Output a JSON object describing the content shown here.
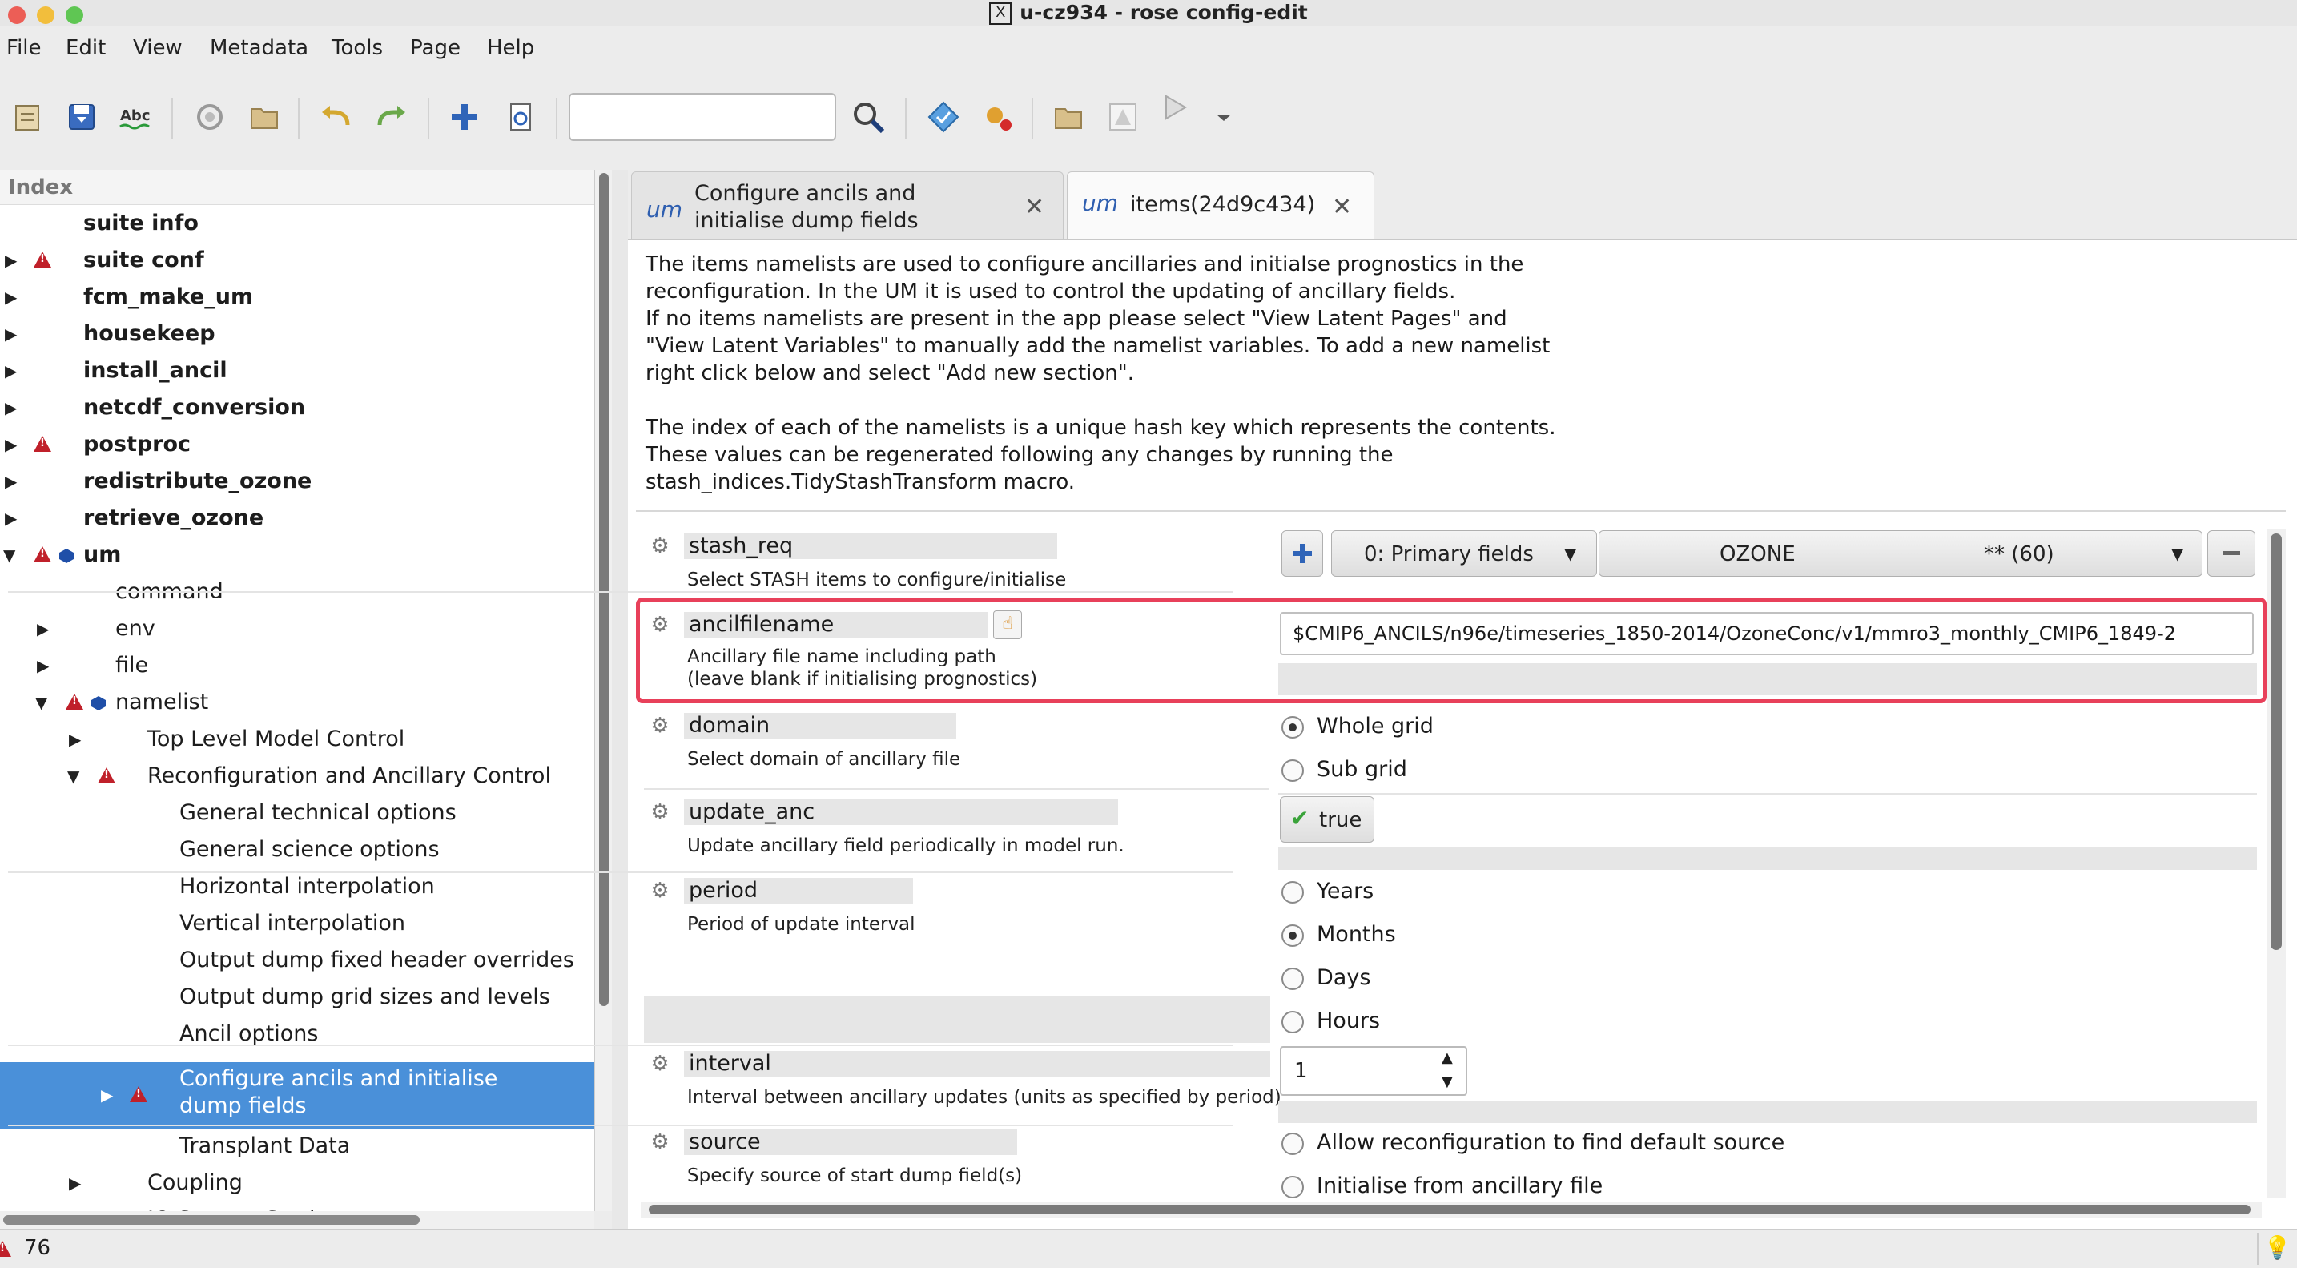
{
  "window": {
    "title": "u-cz934 - rose config-edit"
  },
  "menu": [
    "File",
    "Edit",
    "View",
    "Metadata",
    "Tools",
    "Page",
    "Help"
  ],
  "toolbar": {
    "search_value": "",
    "icons": [
      "open-icon",
      "save-icon",
      "spell-check-icon",
      "reload-icon",
      "folder-icon",
      "undo-icon",
      "redo-icon",
      "add-icon",
      "refresh-page-icon",
      "search-icon",
      "validate-icon",
      "macro-icon",
      "folder-open-icon",
      "warning-icon",
      "run-icon",
      "dropdown-icon"
    ]
  },
  "index": {
    "header": "Index",
    "items": [
      {
        "label": "suite info"
      },
      {
        "label": "suite conf"
      },
      {
        "label": "fcm_make_um"
      },
      {
        "label": "housekeep"
      },
      {
        "label": "install_ancil"
      },
      {
        "label": "netcdf_conversion"
      },
      {
        "label": "postproc"
      },
      {
        "label": "redistribute_ozone"
      },
      {
        "label": "retrieve_ozone"
      },
      {
        "label": "um"
      },
      {
        "label": "command"
      },
      {
        "label": "env"
      },
      {
        "label": "file"
      },
      {
        "label": "namelist"
      },
      {
        "label": "Top Level Model Control"
      },
      {
        "label": "Reconfiguration and Ancillary Control"
      },
      {
        "label": "General technical options"
      },
      {
        "label": "General science options"
      },
      {
        "label": "Horizontal interpolation"
      },
      {
        "label": "Vertical interpolation"
      },
      {
        "label": "Output dump fixed header overrides"
      },
      {
        "label": "Output dump grid sizes and levels"
      },
      {
        "label": "Ancil options"
      },
      {
        "label": "Configure ancils and initialise dump fields"
      },
      {
        "label": "Transplant Data"
      },
      {
        "label": "Coupling"
      },
      {
        "label": "IO System Settings"
      }
    ]
  },
  "tabs": [
    {
      "label": "Configure ancils and initialise dump fields",
      "icon": "um"
    },
    {
      "label": "items(24d9c434)",
      "icon": "um"
    }
  ],
  "description": {
    "para1_line1": "The items namelists are used to configure ancillaries and initialse prognostics in the",
    "para1_line2": "reconfiguration. In the UM it is used to control the updating of ancillary fields.",
    "para1_line3": "If no items namelists are present in the app please select \"View Latent Pages\" and",
    "para1_line4": "\"View Latent Variables\" to manually add the namelist variables. To add a new namelist",
    "para1_line5": "right click below and select \"Add new section\".",
    "para2_line1": "The index of each of the namelists is a unique hash key which represents the contents.",
    "para2_line2": "These values can be regenerated following any changes by running the",
    "para2_line3": "stash_indices.TidyStashTransform macro."
  },
  "variables": {
    "stash_req": {
      "name": "stash_req",
      "help": "Select STASH items to configure/initialise",
      "section": "0: Primary fields",
      "item": "OZONE",
      "item_code": "** (60)"
    },
    "ancilfilename": {
      "name": "ancilfilename",
      "help_line1": "Ancillary file name including path",
      "help_line2": "(leave blank if initialising prognostics)",
      "value": "$CMIP6_ANCILS/n96e/timeseries_1850-2014/OzoneConc/v1/mmro3_monthly_CMIP6_1849-2"
    },
    "domain": {
      "name": "domain",
      "help": "Select domain of ancillary file",
      "options": [
        "Whole grid",
        "Sub grid"
      ],
      "selected": "Whole grid"
    },
    "update_anc": {
      "name": "update_anc",
      "help": "Update ancillary field periodically in model run.",
      "value": "true"
    },
    "period": {
      "name": "period",
      "help": "Period of update interval",
      "options": [
        "Years",
        "Months",
        "Days",
        "Hours"
      ],
      "selected": "Months"
    },
    "interval": {
      "name": "interval",
      "help": "Interval between ancillary updates (units as specified by period)",
      "value": "1"
    },
    "source": {
      "name": "source",
      "help": "Specify source of start dump field(s)",
      "options": [
        "Allow reconfiguration to find default source",
        "Initialise from ancillary file"
      ]
    }
  },
  "status": {
    "error_count": "76"
  },
  "colors": {
    "selection": "#4a90d9",
    "highlight_border": "#e8405a",
    "warning": "#c0202a"
  }
}
